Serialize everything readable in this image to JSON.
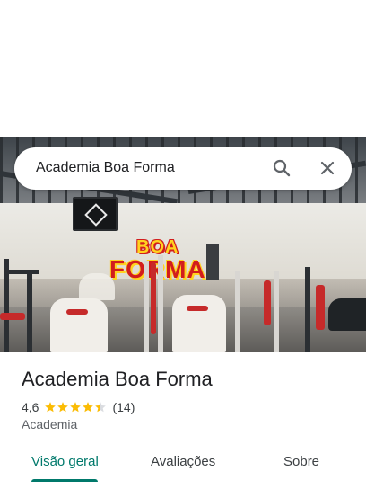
{
  "search": {
    "query": "Academia Boa Forma",
    "search_icon": "search-icon",
    "close_icon": "close-icon"
  },
  "hero": {
    "logo_line1": "BOA",
    "logo_line2": "FORMA"
  },
  "place": {
    "name": "Academia Boa Forma",
    "rating": "4,6",
    "stars_filled": 4.5,
    "review_count": "(14)",
    "category": "Academia"
  },
  "tabs": [
    {
      "label": "Visão geral",
      "active": true
    },
    {
      "label": "Avaliações",
      "active": false
    },
    {
      "label": "Sobre",
      "active": false
    }
  ],
  "colors": {
    "accent": "#00796b",
    "star": "#fbbc04",
    "text_primary": "#202124",
    "text_secondary": "#5f6368"
  }
}
